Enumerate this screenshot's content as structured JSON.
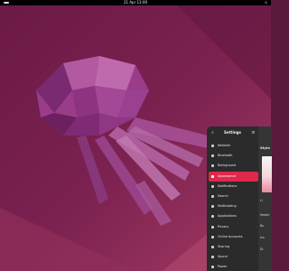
{
  "topbar": {
    "clock": "21 Apr  13:00",
    "tray": "⏻"
  },
  "settings": {
    "title": "Settings",
    "search_icon": "search-icon",
    "menu_icon": "hamburger-icon",
    "items": [
      {
        "label": "Network",
        "icon": "network-icon"
      },
      {
        "label": "Bluetooth",
        "icon": "bluetooth-icon"
      },
      {
        "label": "Background",
        "icon": "background-icon"
      },
      {
        "label": "Appearance",
        "icon": "appearance-icon"
      },
      {
        "label": "Notifications",
        "icon": "bell-icon"
      },
      {
        "label": "Search",
        "icon": "search-icon"
      },
      {
        "label": "Multitasking",
        "icon": "multitasking-icon"
      },
      {
        "label": "Applications",
        "icon": "apps-icon"
      },
      {
        "label": "Privacy",
        "icon": "lock-icon"
      },
      {
        "label": "Online Accounts",
        "icon": "cloud-icon"
      },
      {
        "label": "Sharing",
        "icon": "share-icon"
      },
      {
        "label": "Sound",
        "icon": "speaker-icon"
      },
      {
        "label": "Power",
        "icon": "power-icon"
      }
    ],
    "active_index": 3,
    "content": {
      "section": "Style",
      "labels": [
        "Li",
        "Heade",
        "Bu",
        "Ico",
        "Di"
      ]
    }
  }
}
